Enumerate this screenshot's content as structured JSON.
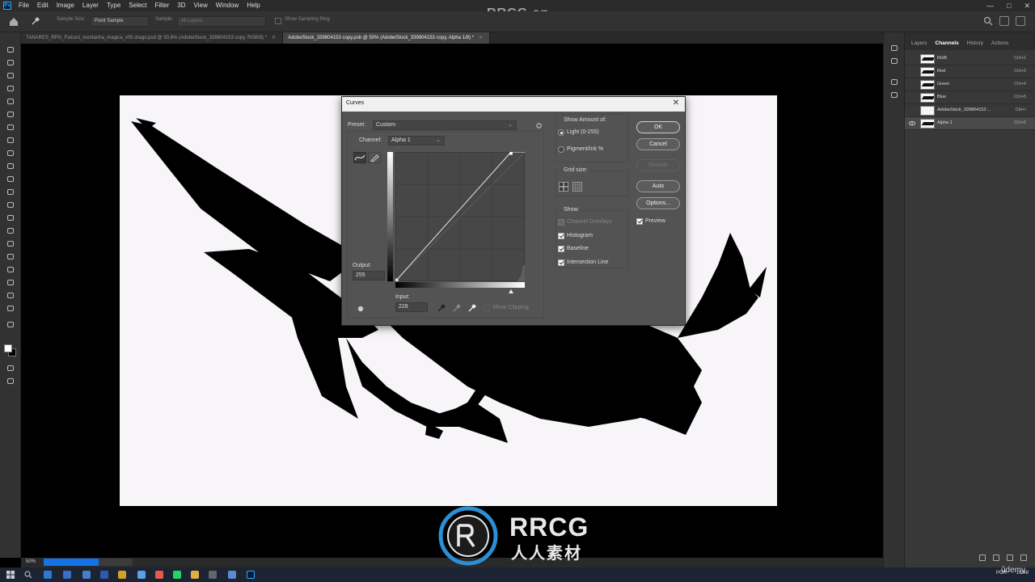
{
  "watermark": "RRCG.cn",
  "menu": [
    "File",
    "Edit",
    "Image",
    "Layer",
    "Type",
    "Select",
    "Filter",
    "3D",
    "View",
    "Window",
    "Help"
  ],
  "options_bar": {
    "sample_size_label": "Sample Size:",
    "sample_size_value": "Point Sample",
    "sample_label": "Sample:",
    "sample_value": "All Layers",
    "show_ring_label": "Show Sampling Ring"
  },
  "doc_tabs": [
    {
      "title": "TANARES_RPG_Falconi_montanha_magica_v05 drago.psd @ 50,6% (AdobeStock_339804153 copy, RGB/8) *",
      "active": false
    },
    {
      "title": "AdobeStock_339804153 copy.psb @ 50% (AdobeStock_339804153 copy, Alpha 1/8) *",
      "active": true
    }
  ],
  "status": {
    "zoom": "50%",
    "progress": 0.62
  },
  "panel": {
    "tabs": [
      "Layers",
      "Channels",
      "History",
      "Actions"
    ],
    "active_tab": "Channels",
    "channels": [
      {
        "name": "RGB",
        "shortcut": "Ctrl+2",
        "selected": false,
        "visible": false,
        "italic": false
      },
      {
        "name": "Red",
        "shortcut": "Ctrl+3",
        "selected": false,
        "visible": false,
        "italic": false
      },
      {
        "name": "Green",
        "shortcut": "Ctrl+4",
        "selected": false,
        "visible": false,
        "italic": false
      },
      {
        "name": "Blue",
        "shortcut": "Ctrl+5",
        "selected": false,
        "visible": false,
        "italic": false
      },
      {
        "name": "AdobeStock_339804153 ...",
        "shortcut": "Ctrl+\\",
        "selected": false,
        "visible": false,
        "italic": true
      },
      {
        "name": "Alpha 1",
        "shortcut": "Ctrl+6",
        "selected": true,
        "visible": true,
        "italic": false
      }
    ]
  },
  "dialog": {
    "title": "Curves",
    "preset_label": "Preset:",
    "preset_value": "Custom",
    "channel_label": "Channel:",
    "channel_value": "Alpha 1",
    "output_label": "Output:",
    "output_value": "255",
    "input_label": "Input:",
    "input_value": "228",
    "show_clipping": "Show Clipping",
    "show_amount_label": "Show Amount of:",
    "light_label": "Light  (0-255)",
    "pigment_label": "Pigment/Ink %",
    "grid_size_label": "Grid size:",
    "show_label": "Show:",
    "channel_overlays": "Channel Overlays",
    "histogram": "Histogram",
    "baseline": "Baseline",
    "intersection_line": "Intersection Line",
    "ok": "OK",
    "cancel": "Cancel",
    "smooth": "Smooth",
    "auto": "Auto",
    "options": "Options...",
    "preview": "Preview",
    "curve_points": [
      [
        0,
        0
      ],
      [
        228,
        255
      ]
    ]
  },
  "brand": {
    "text1": "RRCG",
    "text2": "人人素材"
  },
  "taskbar": {
    "lang": "POR",
    "time": "18:48",
    "udemy": "ûdemy"
  }
}
